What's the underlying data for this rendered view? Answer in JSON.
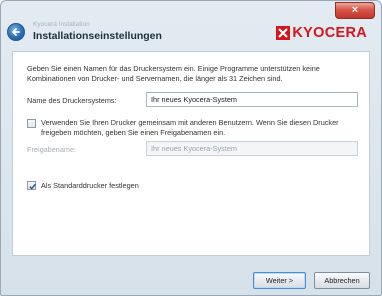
{
  "window": {
    "app_name": "Kyocera Installation",
    "title": "Installationseinstellungen",
    "close_label": "×",
    "logo_text": "KYOCERA",
    "brand_color": "#d4161c"
  },
  "content": {
    "intro": "Geben Sie einen Namen für das Druckersystem ein. Einige Programme unterstützen keine Kombinationen von Drucker- und Servernamen, die länger als 31 Zeichen sind.",
    "printer_name_label": "Name des Druckersystems:",
    "printer_name_value": "Ihr neues Kyocera-System",
    "share_checkbox_label": "Verwenden Sie Ihren Drucker gemeinsam mit anderen Benutzern. Wenn Sie diesen Drucker freigeben möchten, geben Sie einen Freigabenamen ein.",
    "share_checked": false,
    "share_name_label": "Freigabename:",
    "share_name_value": "Ihr neues Kyocera-System",
    "default_checkbox_label": "Als Standarddrucker festlegen",
    "default_checked": true
  },
  "buttons": {
    "next": "Weiter >",
    "cancel": "Abbrechen"
  },
  "icons": {
    "back": "back-arrow-icon",
    "logo": "kyocera-logo-icon",
    "checkmark": "checkmark-icon"
  }
}
